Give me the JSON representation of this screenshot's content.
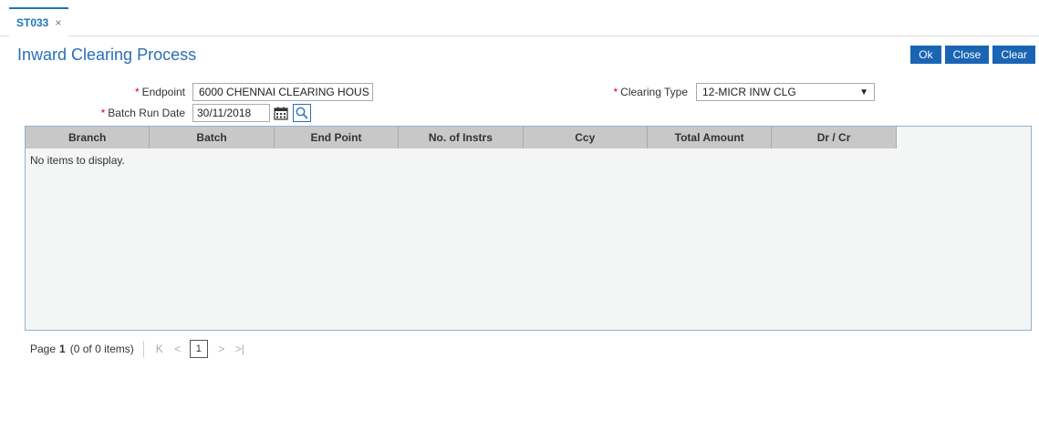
{
  "tab": {
    "label": "ST033",
    "close": "×"
  },
  "title": "Inward Clearing Process",
  "actions": {
    "ok": "Ok",
    "close": "Close",
    "clear": "Clear"
  },
  "form": {
    "required_mark": "*",
    "endpoint": {
      "label": "Endpoint",
      "value": "6000 CHENNAI CLEARING HOUS"
    },
    "clearing_type": {
      "label": "Clearing Type",
      "value": "12-MICR INW CLG"
    },
    "batch_run_date": {
      "label": "Batch Run Date",
      "value": "30/11/2018"
    }
  },
  "grid": {
    "columns": [
      "Branch",
      "Batch",
      "End Point",
      "No. of Instrs",
      "Ccy",
      "Total Amount",
      "Dr / Cr"
    ],
    "empty_text": "No items to display."
  },
  "pager": {
    "label": "Page",
    "current": "1",
    "summary": "(0 of 0 items)",
    "page_box": "1",
    "first": "K",
    "prev": "<",
    "next": ">",
    "last": ">|"
  },
  "icons": {
    "calendar": "calendar-icon",
    "search": "search-icon",
    "caret": "caret-down-icon"
  },
  "colors": {
    "accent": "#1a65b3",
    "title": "#2a6fb5",
    "required": "#d0021b"
  }
}
